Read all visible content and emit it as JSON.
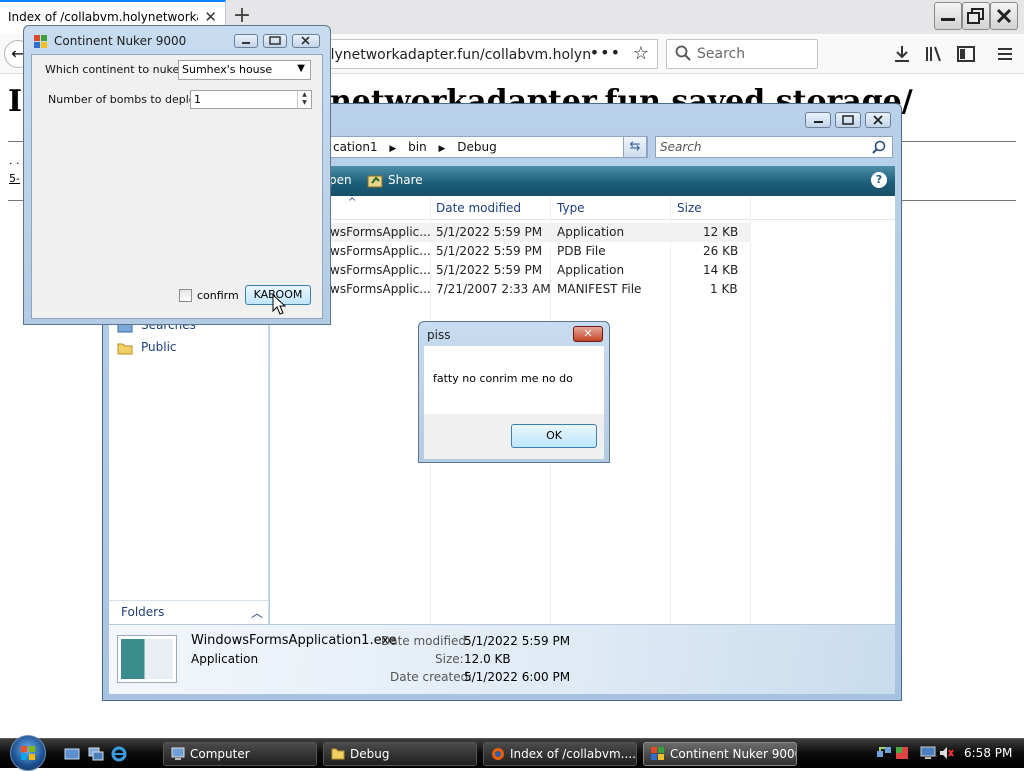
{
  "browser": {
    "tab_title": "Index of /collabvm.holynetworkad",
    "tab_close": "✕",
    "new_tab": "+",
    "url_visible": "olynetworkadapter.fun/collabvm.holyn",
    "search_placeholder": "Search",
    "page_heading_start": "I",
    "page_heading_tail": "networkadapter.fun saved storage/",
    "page_fragment_1": ". .",
    "page_fragment_2": "5-"
  },
  "explorer": {
    "address": {
      "seg1": "cation1",
      "seg2": "bin",
      "seg3": "Debug"
    },
    "search_placeholder": "Search",
    "cmd": {
      "open": "pen",
      "share": "Share",
      "help": "?"
    },
    "nav": {
      "searches": "Searches",
      "public": "Public",
      "folders": "Folders"
    },
    "columns": {
      "name_sort": "^",
      "date": "Date modified",
      "type": "Type",
      "size": "Size"
    },
    "files": [
      {
        "name": "wsFormsApplic...",
        "date": "5/1/2022 5:59 PM",
        "type": "Application",
        "size": "12 KB"
      },
      {
        "name": "wsFormsApplic...",
        "date": "5/1/2022 5:59 PM",
        "type": "PDB File",
        "size": "26 KB"
      },
      {
        "name": "wsFormsApplic...",
        "date": "5/1/2022 5:59 PM",
        "type": "Application",
        "size": "14 KB"
      },
      {
        "name": "wsFormsApplic...",
        "date": "7/21/2007 2:33 AM",
        "type": "MANIFEST File",
        "size": "1 KB"
      }
    ],
    "details": {
      "filename": "WindowsFormsApplication1.exe",
      "filetype": "Application",
      "modified_label": "Date modified:",
      "modified_value": "5/1/2022 5:59 PM",
      "size_label": "Size:",
      "size_value": "12.0 KB",
      "created_label": "Date created:",
      "created_value": "5/1/2022 6:00 PM"
    }
  },
  "nuker": {
    "title": "Continent Nuker 9000",
    "continent_label": "Which continent to nuke?",
    "continent_value": "Sumhex's house",
    "bombs_label": "Number of bombs to deploy:",
    "bombs_value": "1",
    "confirm_label": "confirm",
    "confirm_checked": false,
    "kaboom_label": "KABOOM"
  },
  "msgbox": {
    "title": "piss",
    "close": "✕",
    "text": "fatty no conrim me no do",
    "ok": "OK"
  },
  "taskbar": {
    "items": [
      {
        "label": "Computer"
      },
      {
        "label": "Debug"
      },
      {
        "label": "Index of /collabvm...."
      },
      {
        "label": "Continent Nuker 9000"
      }
    ],
    "clock": "6:58 PM"
  },
  "colors": {
    "vista_accent": "#1d5f7a",
    "firefox_accent": "#0a84ff"
  }
}
